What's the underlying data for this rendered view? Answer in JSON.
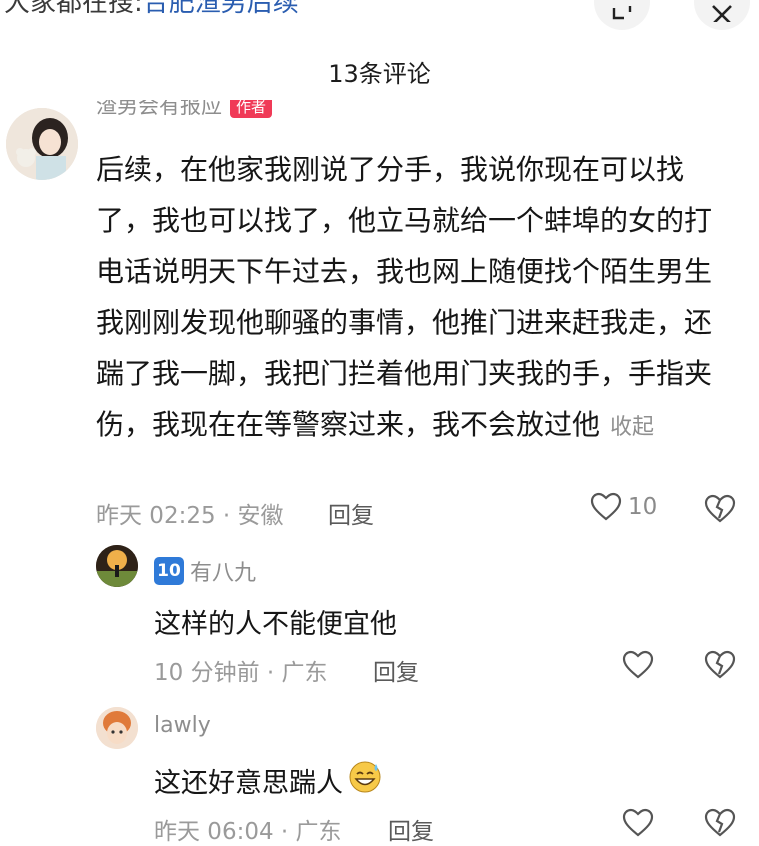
{
  "top": {
    "search_prefix": "大家都在搜:",
    "search_keyword": "合肥渣男后续",
    "search_icon": "search-icon",
    "expand_icon": "expand-icon",
    "close_icon": "close-icon"
  },
  "header": {
    "comment_count": "13条评论"
  },
  "main_comment": {
    "author": "渣男会有报应",
    "badge": "作者",
    "text": "后续，在他家我刚说了分手，我说你现在可以找了，我也可以找了，他立马就给一个蚌埠的女的打电话说明天下午过去，我也网上随便找个陌生男生我刚刚发现他聊骚的事情，他推门进来赶我走，还踹了我一脚，我把门拦着他用门夹我的手，手指夹伤，我现在在等警察过来，我不会放过他",
    "collapse": "收起",
    "time_location": "昨天 02:25 · 安徽",
    "reply": "回复",
    "likes": "10"
  },
  "replies": [
    {
      "badge": "🔟",
      "author": "有八九",
      "text": "这样的人不能便宜他",
      "time_location": "10 分钟前 · 广东",
      "reply": "回复"
    },
    {
      "author": "lawly",
      "text": "这还好意思踹人",
      "emoji": "sweat-smile-emoji",
      "time_location": "昨天 06:04 · 广东",
      "reply": "回复"
    }
  ],
  "colors": {
    "badge_red": "#f03a57",
    "link_blue": "#2a5db0",
    "meta_gray": "#9a9a9a"
  }
}
